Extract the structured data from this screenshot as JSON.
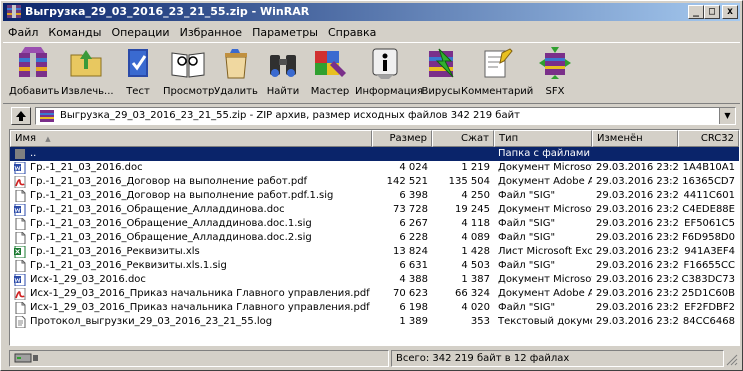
{
  "window": {
    "title": "Выгрузка_29_03_2016_23_21_55.zip - WinRAR",
    "minimize_label": "_",
    "restore_label": "□",
    "close_label": "x"
  },
  "menu": [
    "Файл",
    "Команды",
    "Операции",
    "Избранное",
    "Параметры",
    "Справка"
  ],
  "toolbar": {
    "add": "Добавить",
    "extract": "Извлечь...",
    "test": "Тест",
    "view": "Просмотр",
    "delete": "Удалить",
    "find": "Найти",
    "wizard": "Мастер",
    "info": "Информация",
    "virus": "Вирусы",
    "comment": "Комментарий",
    "sfx": "SFX"
  },
  "address": {
    "text": "Выгрузка_29_03_2016_23_21_55.zip - ZIP архив, размер исходных файлов 342 219 байт",
    "dropdown_glyph": "▼"
  },
  "columns": {
    "name": "Имя",
    "sort_glyph": "▲",
    "size": "Размер",
    "packed": "Сжат",
    "type": "Тип",
    "modified": "Изменён",
    "crc": "CRC32"
  },
  "files": [
    {
      "name": "..",
      "size": "",
      "packed": "",
      "type": "Папка с файлами",
      "modified": "",
      "crc": "",
      "icon": "folder-up-icon",
      "selected": true
    },
    {
      "name": "Гр.-1_21_03_2016.doc",
      "size": "4 024",
      "packed": "1 219",
      "type": "Документ Microsof...",
      "modified": "29.03.2016 23:21",
      "crc": "1A4B10A1",
      "icon": "word-doc-icon"
    },
    {
      "name": "Гр.-1_21_03_2016_Договор на выполнение работ.pdf",
      "size": "142 521",
      "packed": "135 504",
      "type": "Документ Adobe A...",
      "modified": "29.03.2016 23:21",
      "crc": "16365CD7",
      "icon": "pdf-icon"
    },
    {
      "name": "Гр.-1_21_03_2016_Договор на выполнение работ.pdf.1.sig",
      "size": "6 398",
      "packed": "4 250",
      "type": "Файл \"SIG\"",
      "modified": "29.03.2016 23:21",
      "crc": "4411C601",
      "icon": "blank-file-icon"
    },
    {
      "name": "Гр.-1_21_03_2016_Обращение_Алладдинова.doc",
      "size": "73 728",
      "packed": "19 245",
      "type": "Документ Microsof...",
      "modified": "29.03.2016 23:21",
      "crc": "C4EDE88E",
      "icon": "word-doc-icon"
    },
    {
      "name": "Гр.-1_21_03_2016_Обращение_Алладдинова.doc.1.sig",
      "size": "6 267",
      "packed": "4 118",
      "type": "Файл \"SIG\"",
      "modified": "29.03.2016 23:21",
      "crc": "EF5061C5",
      "icon": "blank-file-icon"
    },
    {
      "name": "Гр.-1_21_03_2016_Обращение_Алладдинова.doc.2.sig",
      "size": "6 228",
      "packed": "4 089",
      "type": "Файл \"SIG\"",
      "modified": "29.03.2016 23:21",
      "crc": "F6D958D0",
      "icon": "blank-file-icon"
    },
    {
      "name": "Гр.-1_21_03_2016_Реквизиты.xls",
      "size": "13 824",
      "packed": "1 428",
      "type": "Лист Microsoft Exc...",
      "modified": "29.03.2016 23:21",
      "crc": "941A3EF4",
      "icon": "excel-icon"
    },
    {
      "name": "Гр.-1_21_03_2016_Реквизиты.xls.1.sig",
      "size": "6 631",
      "packed": "4 503",
      "type": "Файл \"SIG\"",
      "modified": "29.03.2016 23:21",
      "crc": "F16655CC",
      "icon": "blank-file-icon"
    },
    {
      "name": "Исх-1_29_03_2016.doc",
      "size": "4 388",
      "packed": "1 387",
      "type": "Документ Microsof...",
      "modified": "29.03.2016 23:21",
      "crc": "C383DC73",
      "icon": "word-doc-icon"
    },
    {
      "name": "Исх-1_29_03_2016_Приказ начальника Главного управления.pdf",
      "size": "70 623",
      "packed": "66 324",
      "type": "Документ Adobe A...",
      "modified": "29.03.2016 23:21",
      "crc": "25D1C60B",
      "icon": "pdf-icon"
    },
    {
      "name": "Исх-1_29_03_2016_Приказ начальника Главного управления.pdf.1.sig",
      "size": "6 198",
      "packed": "4 020",
      "type": "Файл \"SIG\"",
      "modified": "29.03.2016 23:21",
      "crc": "EF2FDBF2",
      "icon": "blank-file-icon"
    },
    {
      "name": "Протокол_выгрузки_29_03_2016_23_21_55.log",
      "size": "1 389",
      "packed": "353",
      "type": "Текстовый документ",
      "modified": "29.03.2016 23:21",
      "crc": "84CC6468",
      "icon": "text-file-icon"
    }
  ],
  "status": {
    "total": "Всего: 342 219 байт в 12 файлах"
  },
  "colors": {
    "title_start": "#0a246a",
    "title_end": "#a6caf0",
    "selection": "#0a246a",
    "face": "#d4d0c8"
  }
}
